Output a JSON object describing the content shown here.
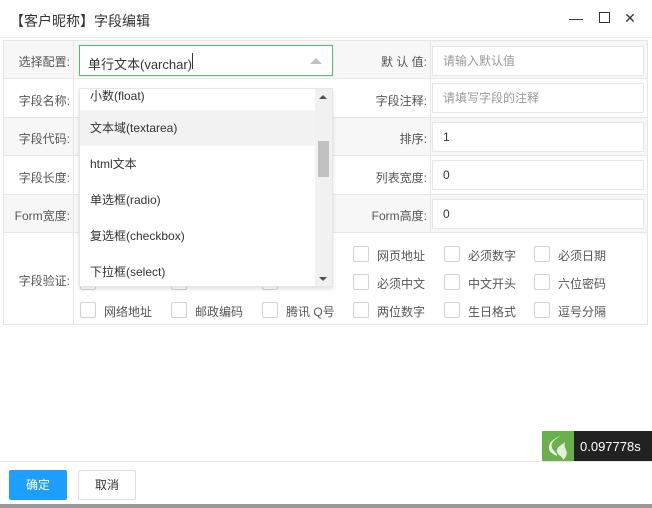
{
  "window": {
    "title": "【客户昵称】字段编辑"
  },
  "form": {
    "select_label": "选择配置:",
    "select_value": "单行文本(varchar)",
    "default_label": "默 认 值:",
    "default_placeholder": "请输入默认值",
    "name_label": "字段名称:",
    "comment_label": "字段注释:",
    "comment_placeholder": "请填写字段的注释",
    "code_label": "字段代码:",
    "order_label": "排序:",
    "order_value": "1",
    "length_label": "字段长度:",
    "list_width_label": "列表宽度:",
    "list_width_value": "0",
    "form_width_label": "Form宽度:",
    "form_height_label": "Form高度:",
    "form_height_value": "0",
    "validate_label": "字段验证:"
  },
  "dropdown": {
    "options": [
      "小数(float)",
      "文本域(textarea)",
      "html文本",
      "单选框(radio)",
      "复选框(checkbox)",
      "下拉框(select)"
    ],
    "hovered": 1
  },
  "validations": {
    "row1": [
      "网页地址",
      "必须数字",
      "必须日期"
    ],
    "row2": [
      "必须中文",
      "中文开头",
      "六位密码"
    ],
    "row3": [
      "网络地址",
      "邮政编码",
      "腾讯 Q号",
      "两位数字",
      "生日格式",
      "逗号分隔"
    ]
  },
  "footer": {
    "ok": "确定",
    "cancel": "取消"
  },
  "timer": {
    "value": "0.097778s"
  }
}
